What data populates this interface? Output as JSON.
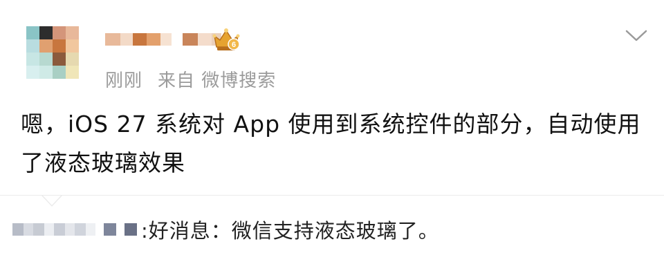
{
  "post": {
    "author": {
      "avatar_colors": [
        "#8ac4c6",
        "#2d2d2d",
        "#d4957a",
        "#e8b89a",
        "#b9dde0",
        "#e0a070",
        "#c8763e",
        "#f1c79e",
        "#c7e6e4",
        "#b7d9d0",
        "#8b5a3c",
        "#e6d9b0",
        "#d8efef",
        "#cfeae6",
        "#a9cfc4",
        "#f0e6b8"
      ],
      "name_colors": [
        "#e8b99a",
        "#f3dac7",
        "#c8763e",
        "#e3a06c",
        "#f6e2d2",
        "#c9855a",
        "#f4dccb",
        "#ead0bc"
      ],
      "badge_level": "6",
      "badge_colors": {
        "gold": "#e6a330",
        "light": "#f8d27a",
        "dark": "#b86f1d"
      }
    },
    "time": "刚刚",
    "source": "来自 微博搜索",
    "text": "嗯，iOS 27 系统对 App 使用到系统控件的部分，自动使用了液态玻璃效果",
    "menu_icon": "chevron-down-icon"
  },
  "repost": {
    "user_colors": [
      "#b7bcc7",
      "#d8dbe2",
      "#c7cbd3",
      "#eceef2",
      "#c9cdd6",
      "#e4e6eb",
      "#d0d4dc",
      "#eef0f3"
    ],
    "square_colors": [
      "#7e869b",
      "#6a7186"
    ],
    "text": ":好消息：微信支持液态玻璃了。"
  },
  "colors": {
    "meta": "#9b9b9b",
    "text": "#111111",
    "divider": "#ebebeb"
  }
}
